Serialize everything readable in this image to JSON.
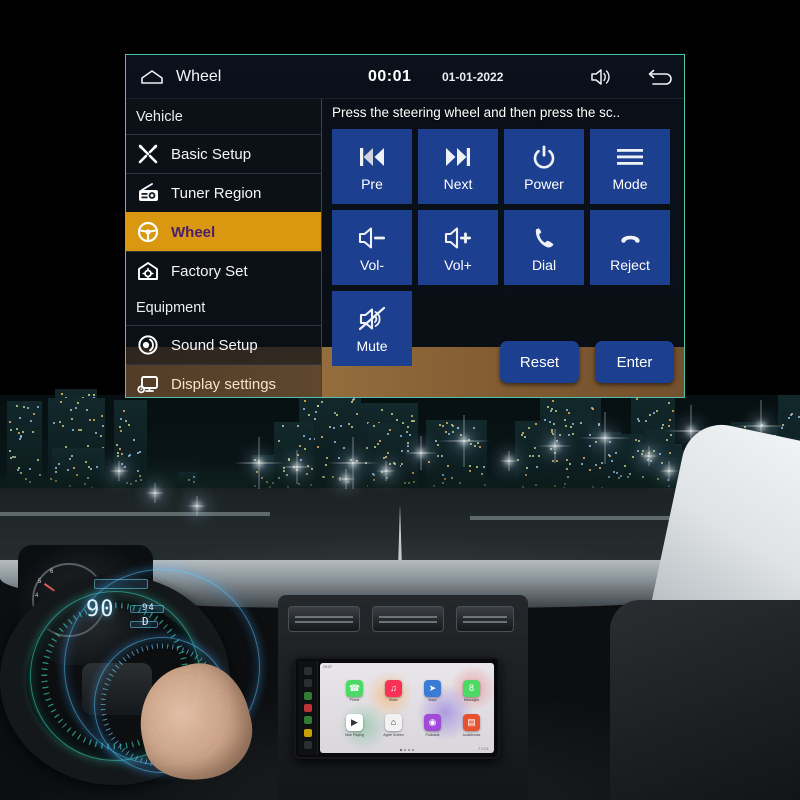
{
  "header": {
    "home_icon": "home-icon",
    "title": "Wheel",
    "clock": "00:01",
    "date": "01-01-2022",
    "volume_icon": "volume-icon",
    "back_icon": "back-arrow-icon"
  },
  "sidebar": {
    "groups": [
      {
        "label": "Vehicle"
      },
      {
        "label": "Equipment"
      }
    ],
    "items": [
      {
        "label": "Basic Setup",
        "icon": "tools-icon",
        "active": false,
        "group": "Vehicle"
      },
      {
        "label": "Tuner Region",
        "icon": "radio-icon",
        "active": false,
        "group": "Vehicle"
      },
      {
        "label": "Wheel",
        "icon": "steering-wheel-icon",
        "active": true,
        "group": "Vehicle"
      },
      {
        "label": "Factory Set",
        "icon": "factory-gear-icon",
        "active": false,
        "group": "Vehicle"
      },
      {
        "label": "Sound Setup",
        "icon": "speaker-disc-icon",
        "active": false,
        "group": "Equipment"
      },
      {
        "label": "Display settings",
        "icon": "monitor-gear-icon",
        "active": false,
        "group": "Equipment"
      }
    ]
  },
  "content": {
    "hint": "Press the steering wheel and then press the sc..",
    "buttons": [
      {
        "label": "Pre",
        "icon": "previous-track-icon"
      },
      {
        "label": "Next",
        "icon": "next-track-icon"
      },
      {
        "label": "Power",
        "icon": "power-icon"
      },
      {
        "label": "Mode",
        "icon": "menu-lines-icon"
      },
      {
        "label": "Vol-",
        "icon": "volume-down-icon"
      },
      {
        "label": "Vol+",
        "icon": "volume-up-icon"
      },
      {
        "label": "Dial",
        "icon": "phone-call-icon"
      },
      {
        "label": "Reject",
        "icon": "phone-hangup-icon"
      },
      {
        "label": "Mute",
        "icon": "mute-icon"
      }
    ],
    "actions": [
      {
        "label": "Reset"
      },
      {
        "label": "Enter"
      }
    ]
  },
  "colors": {
    "panel_border": "#4fbfae",
    "button_blue": "#1d3f8f",
    "active_amber": "#d9980f",
    "active_text": "#4b1d6e",
    "panel_bg": "#0b1018",
    "wood": "#a0763f"
  },
  "headunit_preview": {
    "status_time": "19:37",
    "brand": "7125",
    "apps": [
      {
        "label": "Phone",
        "glyph": "☎",
        "color": "#4cd964"
      },
      {
        "label": "Music",
        "glyph": "♫",
        "color": "#fc3158"
      },
      {
        "label": "Maps",
        "glyph": "➤",
        "color": "#3a7bd5"
      },
      {
        "label": "Messages",
        "glyph": "὞8",
        "color": "#4cd964"
      },
      {
        "label": "Now Playing",
        "glyph": "▶",
        "color": "#ffffff"
      },
      {
        "label": "Apple Screen",
        "glyph": "⌂",
        "color": "#f2f2f2"
      },
      {
        "label": "Podcasts",
        "glyph": "◉",
        "color": "#a24bd8"
      },
      {
        "label": "Audiobooks",
        "glyph": "▤",
        "color": "#e8512f"
      }
    ]
  },
  "hud": {
    "speed": "90",
    "unit": "D",
    "sub": "94"
  }
}
